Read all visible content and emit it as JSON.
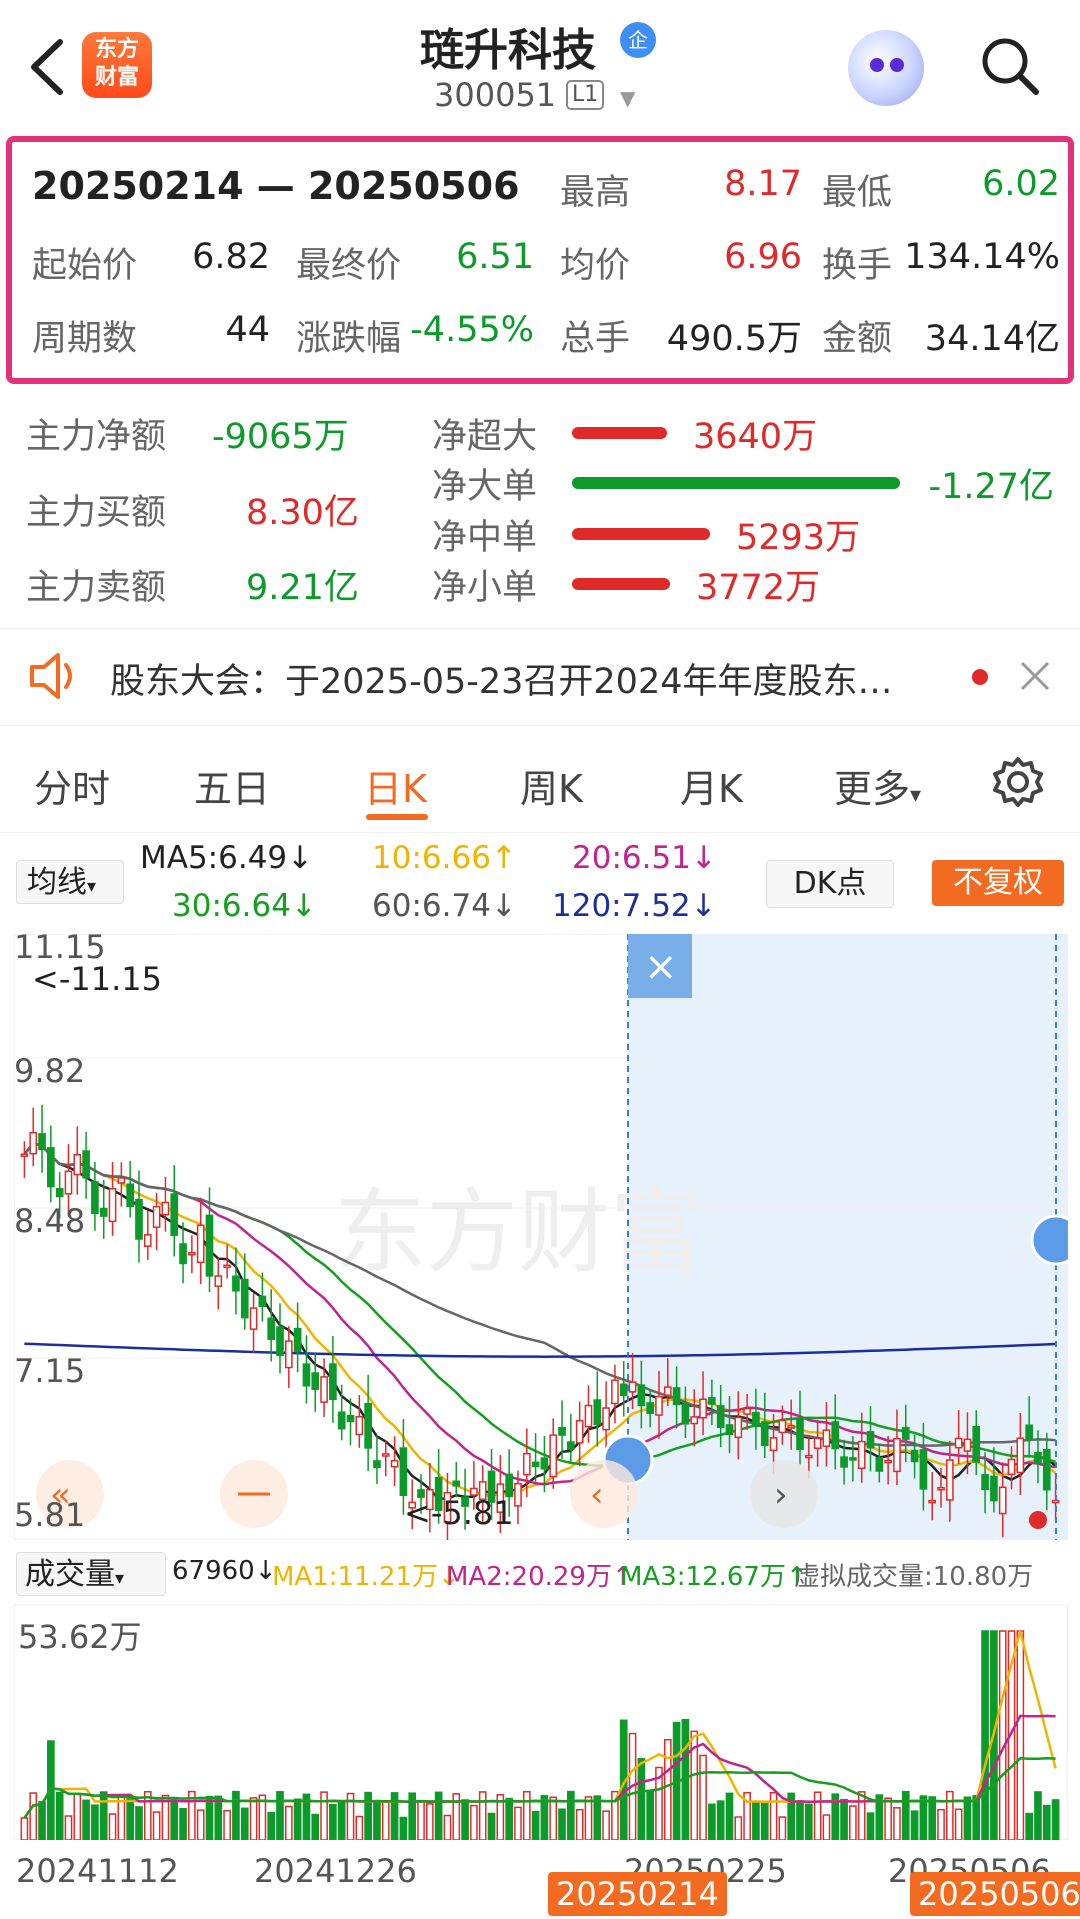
{
  "header": {
    "back_icon": "chevron-left-icon",
    "logo_text": "东方\n财富",
    "title": "琏升科技",
    "title_badge": "企",
    "code": "300051",
    "level": "L1",
    "robot_icon": "robot-assistant-icon",
    "search_icon": "search-icon"
  },
  "summary": {
    "range": "20250214 — 20250506",
    "high_label": "最高",
    "high": "8.17",
    "low_label": "最低",
    "low": "6.02",
    "open_label": "起始价",
    "open": "6.82",
    "close_label": "最终价",
    "close": "6.51",
    "avg_label": "均价",
    "avg": "6.96",
    "turnover_label": "换手",
    "turnover": "134.14%",
    "periods_label": "周期数",
    "periods": "44",
    "change_label": "涨跌幅",
    "change": "-4.55%",
    "volume_label": "总手",
    "volume": "490.5万",
    "amount_label": "金额",
    "amount": "34.14亿"
  },
  "fund_flow": {
    "main_net_label": "主力净额",
    "main_net": "-9065万",
    "main_buy_label": "主力买额",
    "main_buy": "8.30亿",
    "main_sell_label": "主力卖额",
    "main_sell": "9.21亿",
    "rows": [
      {
        "label": "净超大",
        "value": "3640万",
        "color": "#e02a2a",
        "fraction": 0.29
      },
      {
        "label": "净大单",
        "value": "-1.27亿",
        "color": "#0c9a2a",
        "fraction": 1.0
      },
      {
        "label": "净中单",
        "value": "5293万",
        "color": "#e02a2a",
        "fraction": 0.42
      },
      {
        "label": "净小单",
        "value": "3772万",
        "color": "#e02a2a",
        "fraction": 0.3
      }
    ]
  },
  "notice": {
    "icon": "speaker-icon",
    "text": "股东大会：于2025-05-23召开2024年年度股东…",
    "close_icon": "close-icon"
  },
  "tabs": {
    "items": [
      "分时",
      "五日",
      "日K",
      "周K",
      "月K",
      "更多"
    ],
    "active": "日K",
    "settings_icon": "gear-icon"
  },
  "ma": {
    "selector": "均线",
    "ma5": "MA5:6.49↓",
    "ma10": "10:6.66↑",
    "ma20": "20:6.51↓",
    "ma30": "30:6.64↓",
    "ma60": "60:6.74↓",
    "ma120": "120:7.52↓",
    "dk": "DK点",
    "adjust": "不复权"
  },
  "kchart": {
    "y_labels": [
      "11.15",
      "9.82",
      "8.48",
      "7.15",
      "5.81"
    ],
    "max_note": "<-11.15",
    "min_note": "<-5.81",
    "watermark": "东方财富",
    "selection_close": "×"
  },
  "volume": {
    "selector": "成交量",
    "vol": "67960↓",
    "ma1": "MA1:11.21万↓",
    "ma2": "MA2:20.29万↑",
    "ma3": "MA3:12.67万↑",
    "virtual": "虚拟成交量:10.80万",
    "max_label": "53.62万"
  },
  "dates": {
    "d1": "20241112",
    "d2": "20241226",
    "d3": "20250225",
    "d4": "20250506",
    "sel_start": "20250214",
    "sel_end": "20250506"
  },
  "colors": {
    "up": "#e02a2a",
    "down": "#0c9a2a",
    "highlight": "#e0337b",
    "ma5": "#222222",
    "ma10": "#f0b400",
    "ma20": "#c2238f",
    "ma30": "#14a01e",
    "ma60": "#666666",
    "ma120": "#1b2f9a",
    "accent": "#f36a21"
  }
}
